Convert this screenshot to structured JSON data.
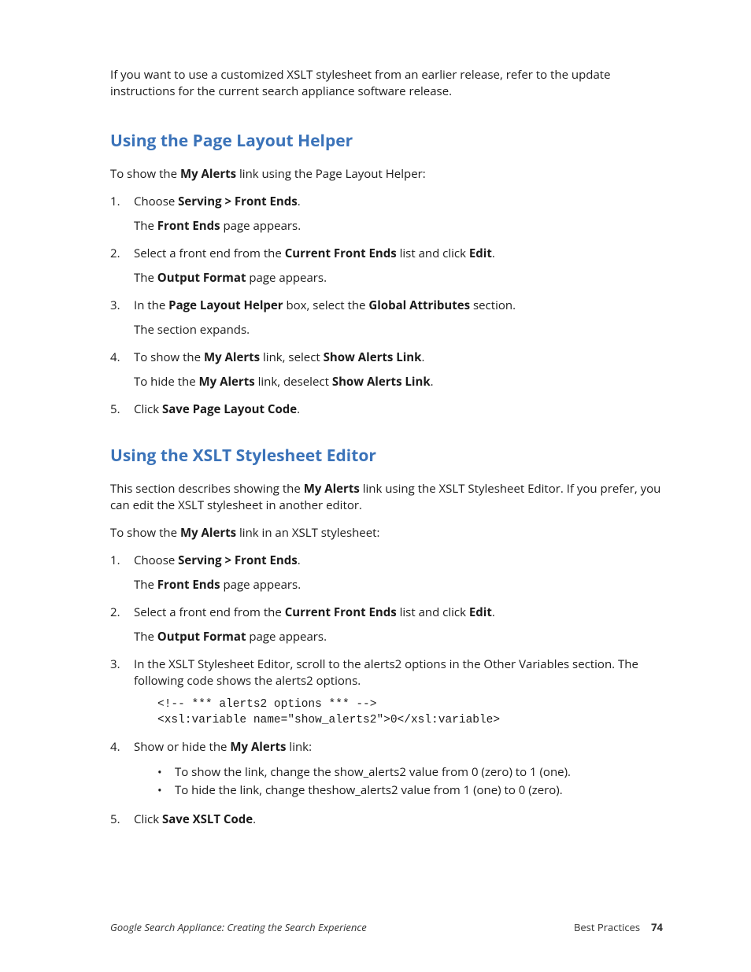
{
  "intro": {
    "pre": "If you want to use a customized XSLT stylesheet from an earlier release, refer to the update instructions for the current search appliance software release."
  },
  "section1": {
    "title": "Using the Page Layout Helper",
    "lead_pre": "To show the ",
    "lead_bold": "My Alerts",
    "lead_post": " link using the Page Layout Helper:",
    "s1_pre": "Choose ",
    "s1_bold": "Serving > Front Ends",
    "s1_post": ".",
    "s1_sub_pre": "The ",
    "s1_sub_bold": "Front Ends",
    "s1_sub_post": " page appears.",
    "s2_pre": "Select a front end from the ",
    "s2_bold1": "Current Front Ends",
    "s2_mid": " list and click ",
    "s2_bold2": "Edit",
    "s2_post": ".",
    "s2_sub_pre": "The ",
    "s2_sub_bold": "Output Format",
    "s2_sub_post": " page appears.",
    "s3_pre": "In the ",
    "s3_bold1": "Page Layout Helper",
    "s3_mid": " box, select the ",
    "s3_bold2": "Global Attributes",
    "s3_post": " section.",
    "s3_sub": "The section expands.",
    "s4_pre": "To show the ",
    "s4_bold1": "My Alerts",
    "s4_mid": " link, select ",
    "s4_bold2": "Show Alerts Link",
    "s4_post": ".",
    "s4_sub_pre": "To hide the ",
    "s4_sub_bold1": "My Alerts",
    "s4_sub_mid": " link, deselect ",
    "s4_sub_bold2": "Show Alerts Link",
    "s4_sub_post": ".",
    "s5_pre": "Click ",
    "s5_bold": "Save Page Layout Code",
    "s5_post": "."
  },
  "section2": {
    "title": "Using the XSLT Stylesheet Editor",
    "para1_pre": "This section describes showing the ",
    "para1_bold": "My Alerts",
    "para1_post": " link using the XSLT Stylesheet Editor. If you prefer, you can edit the XSLT stylesheet in another editor.",
    "para2_pre": "To show the ",
    "para2_bold": "My Alerts",
    "para2_post": " link in an XSLT stylesheet:",
    "s1_pre": "Choose ",
    "s1_bold": "Serving > Front Ends",
    "s1_post": ".",
    "s1_sub_pre": "The ",
    "s1_sub_bold": "Front Ends",
    "s1_sub_post": " page appears.",
    "s2_pre": "Select a front end from the ",
    "s2_bold1": "Current Front Ends",
    "s2_mid": " list and click ",
    "s2_bold2": "Edit",
    "s2_post": ".",
    "s2_sub_pre": "The ",
    "s2_sub_bold": "Output Format",
    "s2_sub_post": " page appears.",
    "s3": "In the XSLT Stylesheet Editor, scroll to the alerts2 options in the Other Variables section. The following code shows the alerts2 options.",
    "code": "<!-- *** alerts2 options *** -->\n<xsl:variable name=\"show_alerts2\">0</xsl:variable>",
    "s4_pre": "Show or hide the ",
    "s4_bold": "My Alerts",
    "s4_post": " link:",
    "b1": "To show the link, change the show_alerts2 value from 0 (zero) to 1 (one).",
    "b2": "To hide the link, change theshow_alerts2 value from 1 (one) to 0 (zero).",
    "s5_pre": "Click ",
    "s5_bold": "Save XSLT Code",
    "s5_post": "."
  },
  "footer": {
    "left": "Google Search Appliance: Creating the Search Experience",
    "right_label": "Best Practices",
    "page": "74"
  }
}
